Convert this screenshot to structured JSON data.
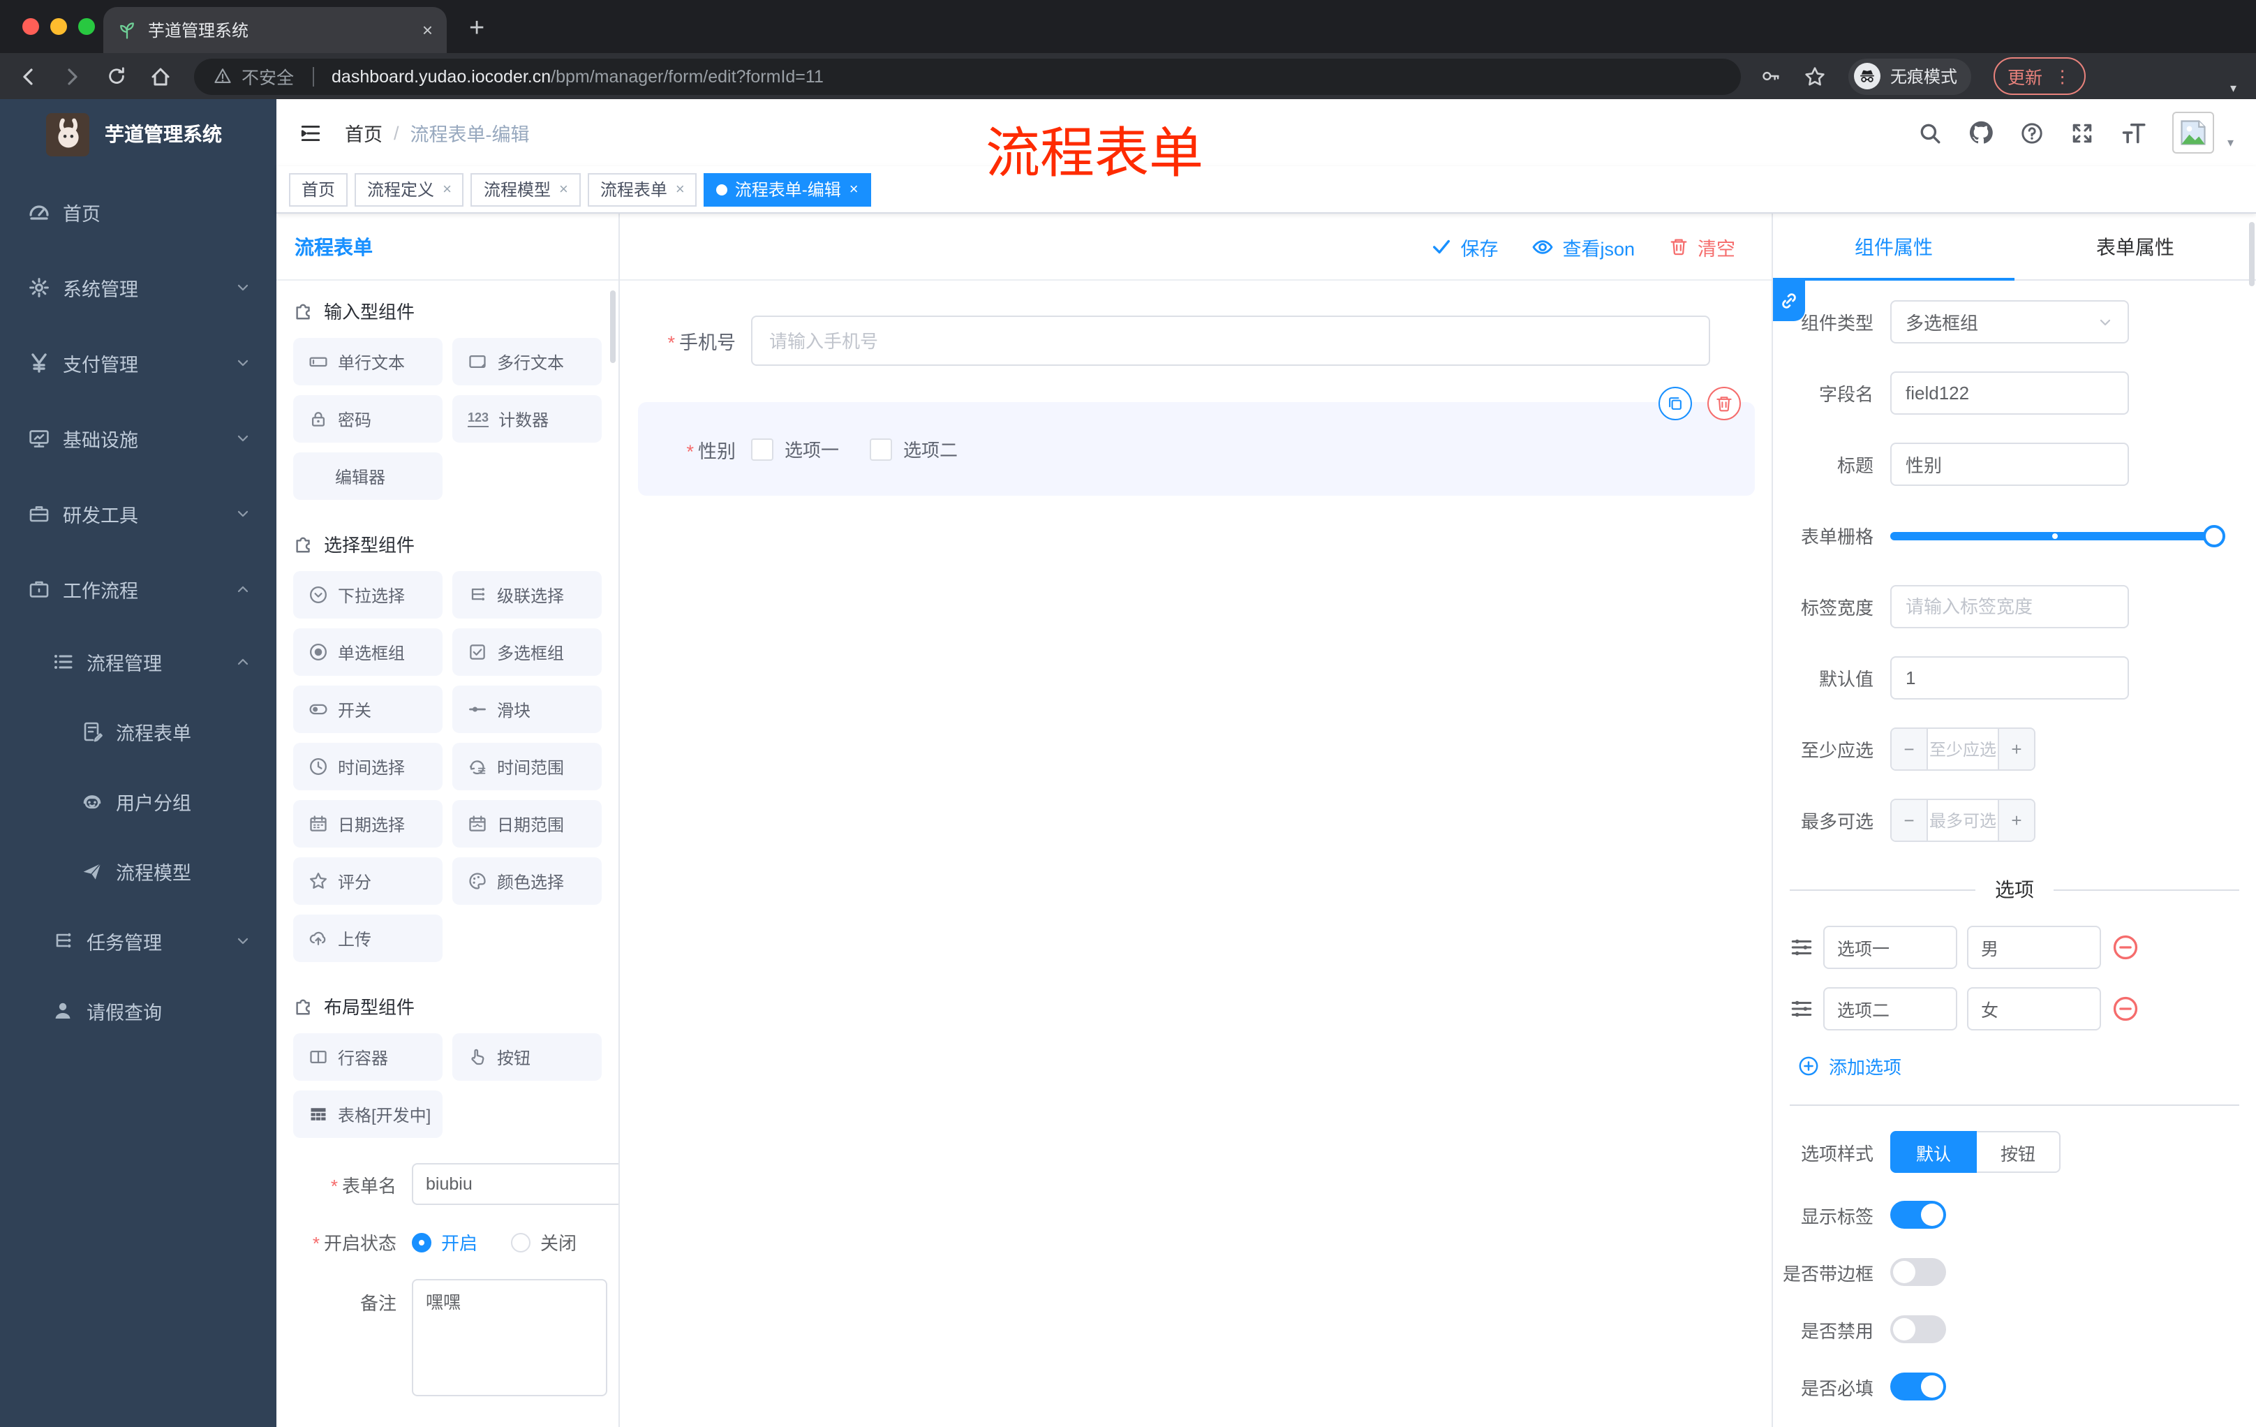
{
  "colors": {
    "accent": "#1890ff",
    "danger": "#f56c6c",
    "annotation": "#fe2b00",
    "sidebar_bg": "#304156"
  },
  "glyphs": {
    "close": "×",
    "plus": "+",
    "minus": "−",
    "dots": "⋮",
    "caret": "▾",
    "slash": "/",
    "newtab": "+"
  },
  "browser": {
    "tab_title": "芋道管理系统",
    "security_label": "不安全",
    "url_domain": "dashboard.yudao.iocoder.cn",
    "url_path": "/bpm/manager/form/edit?formId=11",
    "incognito_label": "无痕模式",
    "update_label": "更新"
  },
  "header": {
    "breadcrumb_home": "首页",
    "breadcrumb_current": "流程表单-编辑",
    "annotation": "流程表单"
  },
  "sidebar": {
    "logo_title": "芋道管理系统",
    "items": [
      {
        "label": "首页"
      },
      {
        "label": "系统管理"
      },
      {
        "label": "支付管理"
      },
      {
        "label": "基础设施"
      },
      {
        "label": "研发工具"
      },
      {
        "label": "工作流程"
      }
    ],
    "process_group": {
      "label": "流程管理",
      "children": [
        {
          "label": "流程表单"
        },
        {
          "label": "用户分组"
        },
        {
          "label": "流程模型"
        }
      ]
    },
    "task_group": {
      "label": "任务管理"
    },
    "leave_item": {
      "label": "请假查询"
    }
  },
  "tags": {
    "items": [
      {
        "label": "首页"
      },
      {
        "label": "流程定义"
      },
      {
        "label": "流程模型"
      },
      {
        "label": "流程表单"
      },
      {
        "label": "流程表单-编辑"
      }
    ]
  },
  "panel": {
    "title": "流程表单",
    "toolbar": {
      "save": "保存",
      "view_json": "查看json",
      "clear": "清空"
    },
    "sections": [
      {
        "title": "输入型组件",
        "items": [
          {
            "label": "单行文本"
          },
          {
            "label": "多行文本"
          },
          {
            "label": "密码"
          },
          {
            "label": "计数器",
            "badge": "123"
          },
          {
            "label": "编辑器"
          }
        ]
      },
      {
        "title": "选择型组件",
        "items": [
          {
            "label": "下拉选择"
          },
          {
            "label": "级联选择"
          },
          {
            "label": "单选框组"
          },
          {
            "label": "多选框组"
          },
          {
            "label": "开关"
          },
          {
            "label": "滑块"
          },
          {
            "label": "时间选择"
          },
          {
            "label": "时间范围"
          },
          {
            "label": "日期选择"
          },
          {
            "label": "日期范围"
          },
          {
            "label": "评分"
          },
          {
            "label": "颜色选择"
          },
          {
            "label": "上传"
          }
        ]
      },
      {
        "title": "布局型组件",
        "items": [
          {
            "label": "行容器"
          },
          {
            "label": "按钮"
          },
          {
            "label": "表格[开发中]"
          }
        ]
      }
    ],
    "form": {
      "name_label": "表单名",
      "name_value": "biubiu",
      "status_label": "开启状态",
      "status_on": "开启",
      "status_off": "关闭",
      "remark_label": "备注",
      "remark_value": "嘿嘿"
    }
  },
  "canvas": {
    "phone": {
      "label": "手机号",
      "placeholder": "请输入手机号"
    },
    "gender": {
      "label": "性别",
      "option1": "选项一",
      "option2": "选项二"
    }
  },
  "inspector": {
    "tab_component": "组件属性",
    "tab_form": "表单属性",
    "component_type": {
      "label": "组件类型",
      "value": "多选框组"
    },
    "field_name": {
      "label": "字段名",
      "value": "field122"
    },
    "title": {
      "label": "标题",
      "value": "性别"
    },
    "grid": {
      "label": "表单栅格"
    },
    "label_width": {
      "label": "标签宽度",
      "placeholder": "请输入标签宽度"
    },
    "default_value": {
      "label": "默认值",
      "value": "1"
    },
    "min_select": {
      "label": "至少应选",
      "placeholder": "至少应选"
    },
    "max_select": {
      "label": "最多可选",
      "placeholder": "最多可选"
    },
    "options_title": "选项",
    "options": [
      {
        "label": "选项一",
        "value": "男"
      },
      {
        "label": "选项二",
        "value": "女"
      }
    ],
    "add_option": "添加选项",
    "style_row": {
      "label": "选项样式",
      "opt_default": "默认",
      "opt_button": "按钮"
    },
    "switches": [
      {
        "label": "显示标签",
        "on": true
      },
      {
        "label": "是否带边框",
        "on": false
      },
      {
        "label": "是否禁用",
        "on": false
      },
      {
        "label": "是否必填",
        "on": true
      }
    ]
  }
}
